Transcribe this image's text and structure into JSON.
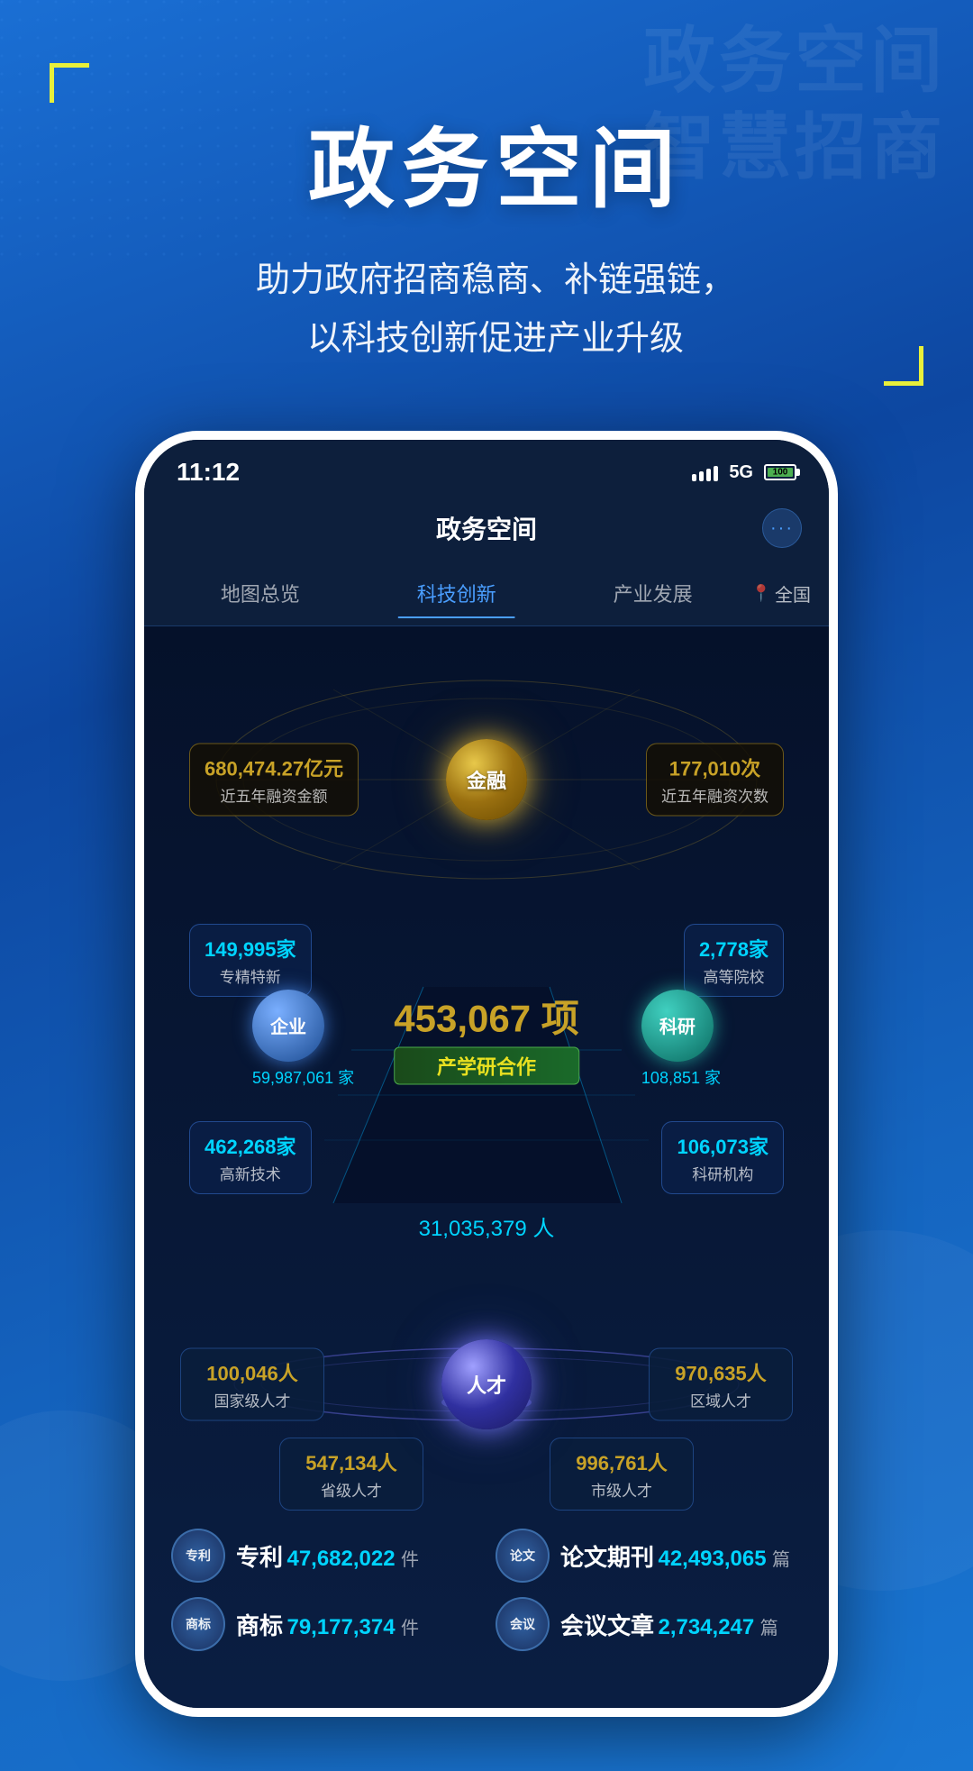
{
  "page": {
    "background_color": "#1565c0",
    "corner_bracket_color": "#e8f03a"
  },
  "header": {
    "main_title": "政务空间",
    "subtitle_line1": "助力政府招商稳商、补链强链，",
    "subtitle_line2": "以科技创新促进产业升级",
    "bg_deco_text_line1": "政务空间",
    "bg_deco_text_line2": "智慧招商"
  },
  "phone": {
    "status_bar": {
      "time": "11:12",
      "signal_5g": "5G",
      "battery_level": "100"
    },
    "app_header": {
      "title": "政务空间",
      "menu_dots": "···"
    },
    "nav_tabs": [
      {
        "label": "地图总览",
        "active": false
      },
      {
        "label": "科技创新",
        "active": true
      },
      {
        "label": "产业发展",
        "active": false
      }
    ],
    "nav_location": "全国",
    "finance": {
      "center_label": "金融",
      "left_stat_number": "680,474.27亿元",
      "left_stat_label": "近五年融资金额",
      "right_stat_number": "177,010次",
      "right_stat_label": "近五年融资次数"
    },
    "industry": {
      "enterprise_label": "企业",
      "enterprise_count": "59,987,061 家",
      "research_label": "科研",
      "research_count": "108,851 家",
      "center_number": "453,067 项",
      "center_label": "产学研合作",
      "top_left_number": "149,995家",
      "top_left_label": "专精特新",
      "top_right_number": "2,778家",
      "top_right_label": "高等院校",
      "bottom_left_number": "462,268家",
      "bottom_left_label": "高新技术",
      "bottom_right_number": "106,073家",
      "bottom_right_label": "科研机构"
    },
    "talent": {
      "total_text": "31,035,379 人",
      "center_label": "人才",
      "national_number": "100,046人",
      "national_label": "国家级人才",
      "regional_number": "970,635人",
      "regional_label": "区域人才",
      "province_number": "547,134人",
      "province_label": "省级人才",
      "city_number": "996,761人",
      "city_label": "市级人才"
    },
    "bottom_stats": [
      {
        "icon_label": "专利",
        "label": "专利",
        "count": "47,682,022",
        "unit": "件"
      },
      {
        "icon_label": "论文",
        "label": "论文期刊",
        "count": "42,493,065",
        "unit": "篇"
      },
      {
        "icon_label": "商标",
        "label": "商标",
        "count": "79,177,374",
        "unit": "件"
      },
      {
        "icon_label": "会议",
        "label": "会议文章",
        "count": "2,734,247",
        "unit": "篇"
      }
    ]
  }
}
